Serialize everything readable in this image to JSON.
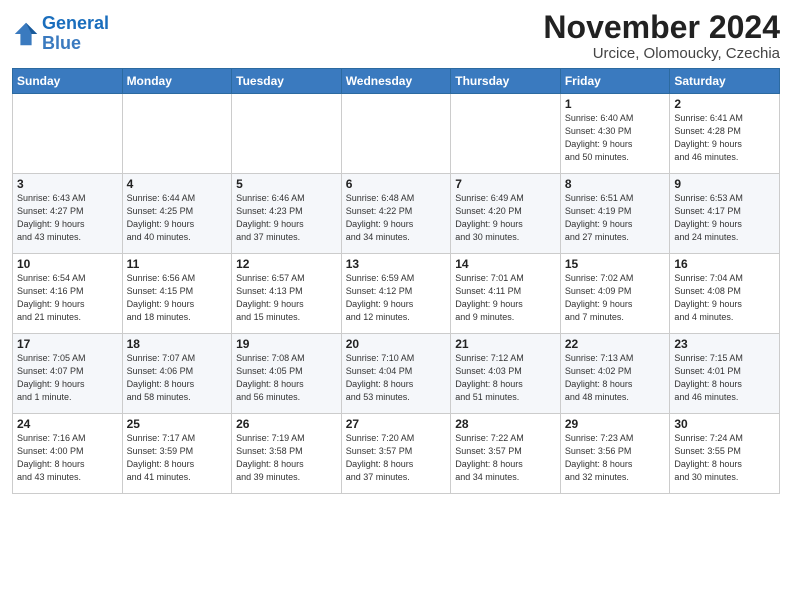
{
  "header": {
    "logo_line1": "General",
    "logo_line2": "Blue",
    "month": "November 2024",
    "location": "Urcice, Olomoucky, Czechia"
  },
  "days_of_week": [
    "Sunday",
    "Monday",
    "Tuesday",
    "Wednesday",
    "Thursday",
    "Friday",
    "Saturday"
  ],
  "weeks": [
    [
      {
        "day": "",
        "info": ""
      },
      {
        "day": "",
        "info": ""
      },
      {
        "day": "",
        "info": ""
      },
      {
        "day": "",
        "info": ""
      },
      {
        "day": "",
        "info": ""
      },
      {
        "day": "1",
        "info": "Sunrise: 6:40 AM\nSunset: 4:30 PM\nDaylight: 9 hours\nand 50 minutes."
      },
      {
        "day": "2",
        "info": "Sunrise: 6:41 AM\nSunset: 4:28 PM\nDaylight: 9 hours\nand 46 minutes."
      }
    ],
    [
      {
        "day": "3",
        "info": "Sunrise: 6:43 AM\nSunset: 4:27 PM\nDaylight: 9 hours\nand 43 minutes."
      },
      {
        "day": "4",
        "info": "Sunrise: 6:44 AM\nSunset: 4:25 PM\nDaylight: 9 hours\nand 40 minutes."
      },
      {
        "day": "5",
        "info": "Sunrise: 6:46 AM\nSunset: 4:23 PM\nDaylight: 9 hours\nand 37 minutes."
      },
      {
        "day": "6",
        "info": "Sunrise: 6:48 AM\nSunset: 4:22 PM\nDaylight: 9 hours\nand 34 minutes."
      },
      {
        "day": "7",
        "info": "Sunrise: 6:49 AM\nSunset: 4:20 PM\nDaylight: 9 hours\nand 30 minutes."
      },
      {
        "day": "8",
        "info": "Sunrise: 6:51 AM\nSunset: 4:19 PM\nDaylight: 9 hours\nand 27 minutes."
      },
      {
        "day": "9",
        "info": "Sunrise: 6:53 AM\nSunset: 4:17 PM\nDaylight: 9 hours\nand 24 minutes."
      }
    ],
    [
      {
        "day": "10",
        "info": "Sunrise: 6:54 AM\nSunset: 4:16 PM\nDaylight: 9 hours\nand 21 minutes."
      },
      {
        "day": "11",
        "info": "Sunrise: 6:56 AM\nSunset: 4:15 PM\nDaylight: 9 hours\nand 18 minutes."
      },
      {
        "day": "12",
        "info": "Sunrise: 6:57 AM\nSunset: 4:13 PM\nDaylight: 9 hours\nand 15 minutes."
      },
      {
        "day": "13",
        "info": "Sunrise: 6:59 AM\nSunset: 4:12 PM\nDaylight: 9 hours\nand 12 minutes."
      },
      {
        "day": "14",
        "info": "Sunrise: 7:01 AM\nSunset: 4:11 PM\nDaylight: 9 hours\nand 9 minutes."
      },
      {
        "day": "15",
        "info": "Sunrise: 7:02 AM\nSunset: 4:09 PM\nDaylight: 9 hours\nand 7 minutes."
      },
      {
        "day": "16",
        "info": "Sunrise: 7:04 AM\nSunset: 4:08 PM\nDaylight: 9 hours\nand 4 minutes."
      }
    ],
    [
      {
        "day": "17",
        "info": "Sunrise: 7:05 AM\nSunset: 4:07 PM\nDaylight: 9 hours\nand 1 minute."
      },
      {
        "day": "18",
        "info": "Sunrise: 7:07 AM\nSunset: 4:06 PM\nDaylight: 8 hours\nand 58 minutes."
      },
      {
        "day": "19",
        "info": "Sunrise: 7:08 AM\nSunset: 4:05 PM\nDaylight: 8 hours\nand 56 minutes."
      },
      {
        "day": "20",
        "info": "Sunrise: 7:10 AM\nSunset: 4:04 PM\nDaylight: 8 hours\nand 53 minutes."
      },
      {
        "day": "21",
        "info": "Sunrise: 7:12 AM\nSunset: 4:03 PM\nDaylight: 8 hours\nand 51 minutes."
      },
      {
        "day": "22",
        "info": "Sunrise: 7:13 AM\nSunset: 4:02 PM\nDaylight: 8 hours\nand 48 minutes."
      },
      {
        "day": "23",
        "info": "Sunrise: 7:15 AM\nSunset: 4:01 PM\nDaylight: 8 hours\nand 46 minutes."
      }
    ],
    [
      {
        "day": "24",
        "info": "Sunrise: 7:16 AM\nSunset: 4:00 PM\nDaylight: 8 hours\nand 43 minutes."
      },
      {
        "day": "25",
        "info": "Sunrise: 7:17 AM\nSunset: 3:59 PM\nDaylight: 8 hours\nand 41 minutes."
      },
      {
        "day": "26",
        "info": "Sunrise: 7:19 AM\nSunset: 3:58 PM\nDaylight: 8 hours\nand 39 minutes."
      },
      {
        "day": "27",
        "info": "Sunrise: 7:20 AM\nSunset: 3:57 PM\nDaylight: 8 hours\nand 37 minutes."
      },
      {
        "day": "28",
        "info": "Sunrise: 7:22 AM\nSunset: 3:57 PM\nDaylight: 8 hours\nand 34 minutes."
      },
      {
        "day": "29",
        "info": "Sunrise: 7:23 AM\nSunset: 3:56 PM\nDaylight: 8 hours\nand 32 minutes."
      },
      {
        "day": "30",
        "info": "Sunrise: 7:24 AM\nSunset: 3:55 PM\nDaylight: 8 hours\nand 30 minutes."
      }
    ]
  ]
}
